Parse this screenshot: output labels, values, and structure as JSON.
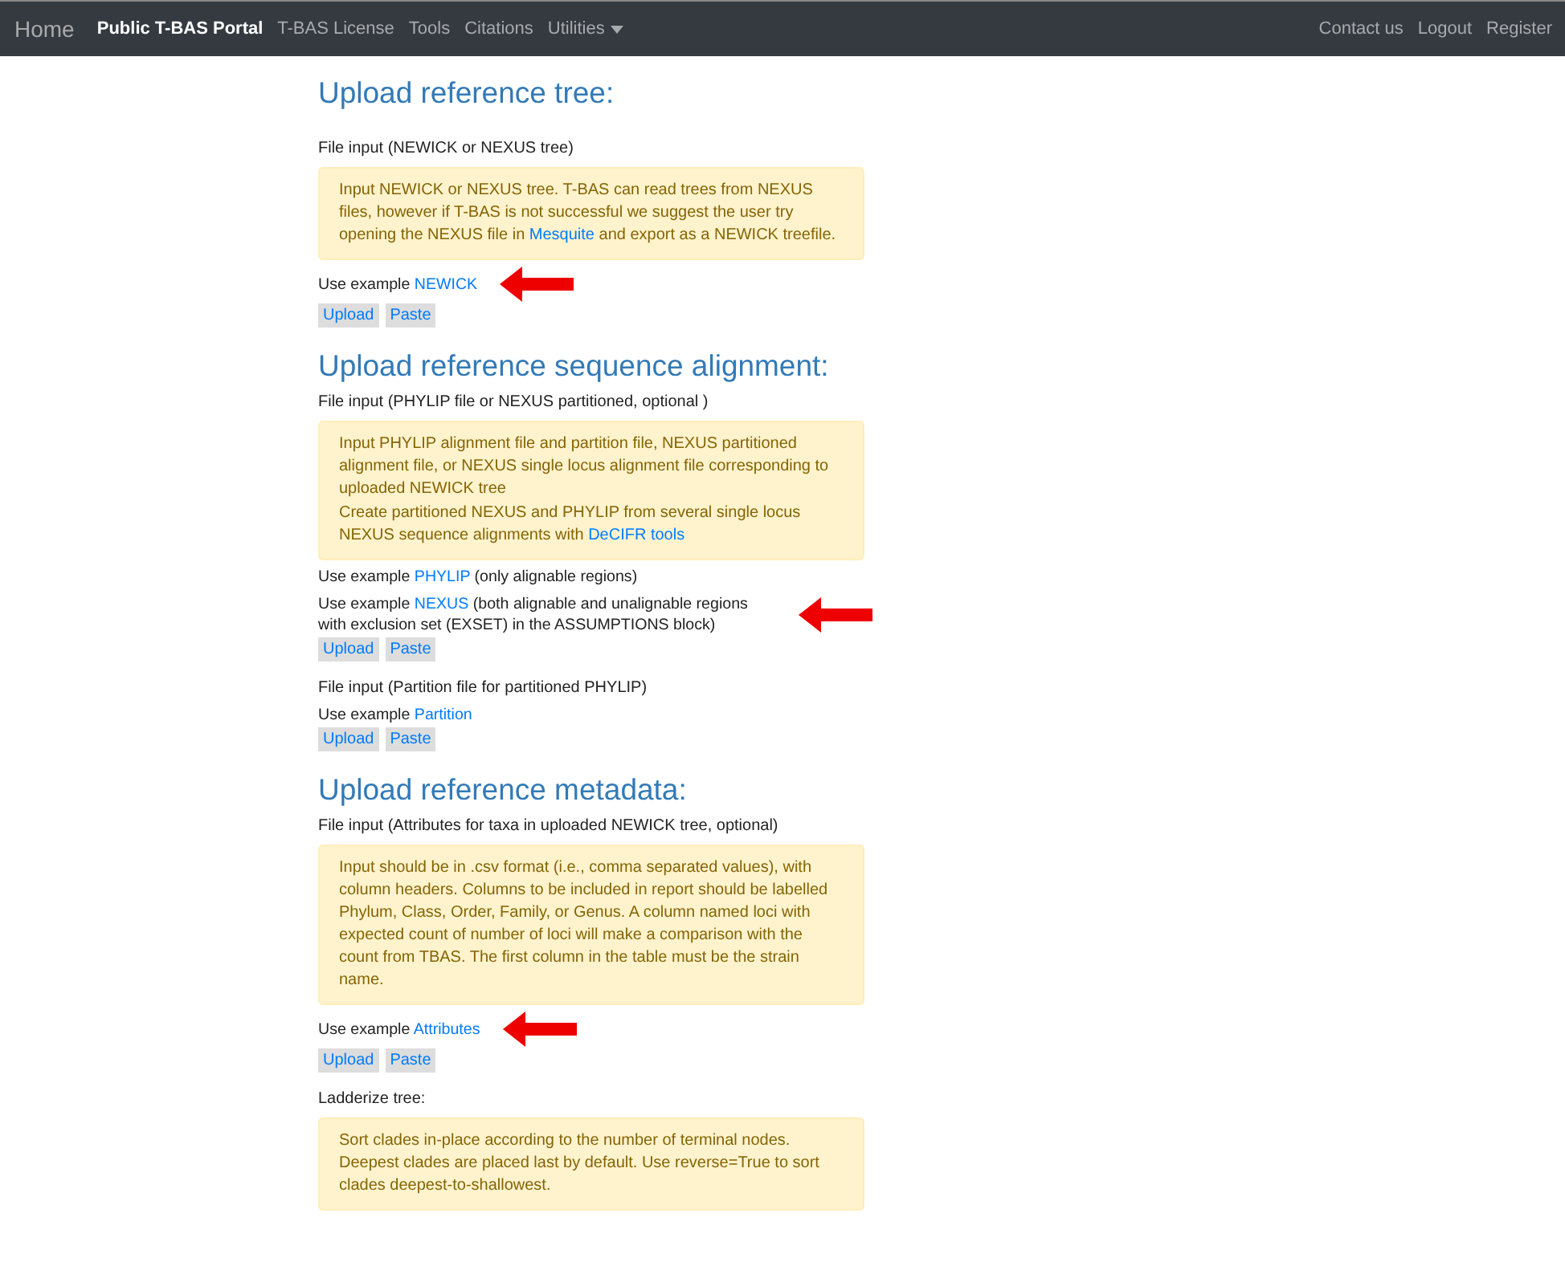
{
  "navbar": {
    "brand": "Home",
    "items": [
      {
        "label": "Public T-BAS Portal",
        "selected": true,
        "dropdown": false
      },
      {
        "label": "T-BAS License",
        "selected": false,
        "dropdown": false
      },
      {
        "label": "Tools",
        "selected": false,
        "dropdown": false
      },
      {
        "label": "Citations",
        "selected": false,
        "dropdown": false
      },
      {
        "label": "Utilities",
        "selected": false,
        "dropdown": true
      }
    ],
    "right_items": [
      "Contact us",
      "Logout",
      "Register"
    ]
  },
  "blocks": [
    {
      "kind": "heading",
      "text": "Upload reference tree:"
    },
    {
      "kind": "label",
      "text": "File input (NEWICK or NEXUS tree)"
    },
    {
      "kind": "note",
      "paragraphs": [
        {
          "parts": [
            {
              "kind": "text",
              "text": "Input NEWICK or NEXUS tree. T-BAS can read trees from NEXUS files, however if T-BAS is not successful we suggest the user try opening the NEXUS file in "
            },
            {
              "kind": "link",
              "text": "Mesquite"
            },
            {
              "kind": "text",
              "text": " and export as a NEWICK treefile."
            }
          ]
        }
      ]
    },
    {
      "kind": "example",
      "arrow": true,
      "parts": [
        {
          "kind": "text",
          "text": "Use example "
        },
        {
          "kind": "link",
          "text": "NEWICK"
        }
      ]
    },
    {
      "kind": "buttons",
      "buttons": [
        "Upload",
        "Paste"
      ]
    },
    {
      "kind": "heading",
      "text": "Upload reference sequence alignment:"
    },
    {
      "kind": "label",
      "text": "File input (PHYLIP file or NEXUS partitioned, optional )"
    },
    {
      "kind": "note",
      "paragraphs": [
        {
          "parts": [
            {
              "kind": "text",
              "text": "Input PHYLIP alignment file and partition file, NEXUS partitioned alignment file, or NEXUS single locus alignment file corresponding to uploaded NEWICK tree"
            }
          ]
        },
        {
          "parts": [
            {
              "kind": "text",
              "text": "Create partitioned NEXUS and PHYLIP from several single locus NEXUS sequence alignments with "
            },
            {
              "kind": "link",
              "text": "DeCIFR tools"
            }
          ]
        }
      ]
    },
    {
      "kind": "example",
      "arrow": false,
      "parts": [
        {
          "kind": "text",
          "text": "Use example "
        },
        {
          "kind": "link",
          "text": "PHYLIP"
        },
        {
          "kind": "text",
          "text": " (only alignable regions)"
        }
      ]
    },
    {
      "kind": "example",
      "arrow": true,
      "parts": [
        {
          "kind": "text",
          "text": "Use example "
        },
        {
          "kind": "link",
          "text": "NEXUS"
        },
        {
          "kind": "text",
          "text": " (both alignable and unalignable regions with exclusion set (EXSET) in the ASSUMPTIONS block)"
        }
      ]
    },
    {
      "kind": "buttons",
      "buttons": [
        "Upload",
        "Paste"
      ]
    },
    {
      "kind": "label",
      "text": "File input (Partition file for partitioned PHYLIP)"
    },
    {
      "kind": "example",
      "arrow": false,
      "parts": [
        {
          "kind": "text",
          "text": "Use example "
        },
        {
          "kind": "link",
          "text": "Partition"
        }
      ]
    },
    {
      "kind": "buttons",
      "buttons": [
        "Upload",
        "Paste"
      ]
    },
    {
      "kind": "heading",
      "text": "Upload reference metadata:"
    },
    {
      "kind": "label",
      "text": "File input (Attributes for taxa in uploaded NEWICK tree, optional)"
    },
    {
      "kind": "note",
      "paragraphs": [
        {
          "parts": [
            {
              "kind": "text",
              "text": "Input should be in .csv format (i.e., comma separated values), with column headers. Columns to be included in report should be labelled Phylum, Class, Order, Family, or Genus. A column named loci with expected count of number of loci will make a comparison with the count from TBAS. The first column in the table must be the strain name."
            }
          ]
        }
      ]
    },
    {
      "kind": "example",
      "arrow": true,
      "parts": [
        {
          "kind": "text",
          "text": "Use example "
        },
        {
          "kind": "link",
          "text": "Attributes"
        }
      ]
    },
    {
      "kind": "buttons",
      "buttons": [
        "Upload",
        "Paste"
      ]
    },
    {
      "kind": "label",
      "text": "Ladderize tree:"
    },
    {
      "kind": "note",
      "paragraphs": [
        {
          "parts": [
            {
              "kind": "text",
              "text": "Sort clades in-place according to the number of terminal nodes. Deepest clades are placed last by default. Use reverse=True to sort clades deepest-to-shallowest."
            }
          ]
        }
      ]
    }
  ]
}
